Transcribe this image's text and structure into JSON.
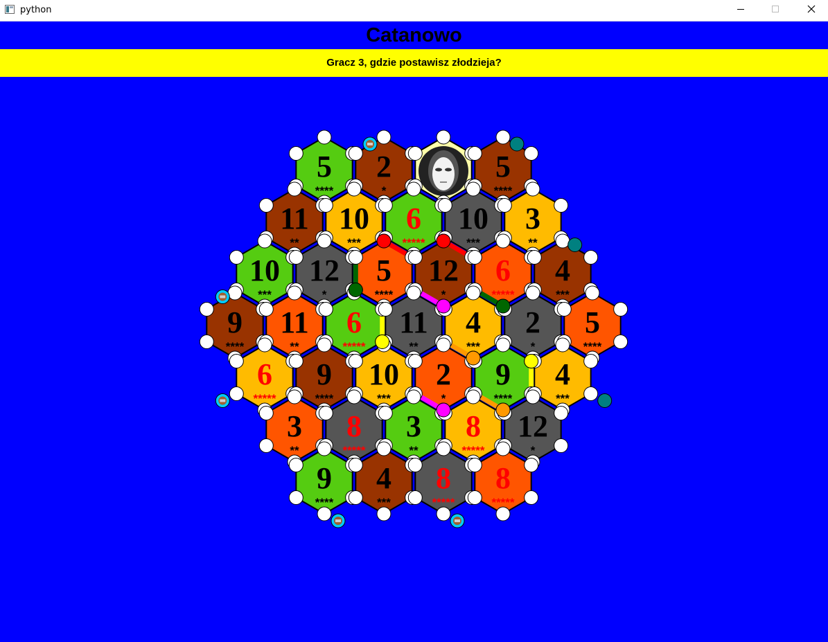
{
  "window": {
    "title": "python",
    "buttons": [
      "minimize",
      "maximize",
      "close"
    ]
  },
  "header": {
    "title": "Catanowo",
    "prompt": "Gracz 3, gdzie postawisz złodzieja?"
  },
  "colors": {
    "background": "#0000ff",
    "prompt_bar": "#ffff00",
    "green": "#55cc11",
    "brown": "#993300",
    "yellow": "#ffbb00",
    "orange": "#ff5500",
    "gray": "#555555",
    "desert": "#ffffaa",
    "hot_number": "#ff0000",
    "player_red": "#ff0000",
    "player_green": "#006600",
    "player_magenta": "#ff00ff",
    "player_yellow": "#ffff00",
    "player_orange": "#ff9900"
  },
  "board": {
    "robber": {
      "row": 0,
      "col": 2,
      "icon": "robber-mask-icon"
    },
    "rows": [
      [
        {
          "num": "5",
          "stars": "****",
          "terrain": "green"
        },
        {
          "num": "2",
          "stars": "*",
          "terrain": "brown"
        },
        {
          "num": "",
          "stars": "",
          "terrain": "desert"
        },
        {
          "num": "5",
          "stars": "****",
          "terrain": "brown"
        }
      ],
      [
        {
          "num": "11",
          "stars": "**",
          "terrain": "brown"
        },
        {
          "num": "10",
          "stars": "***",
          "terrain": "yellow"
        },
        {
          "num": "6",
          "stars": "*****",
          "terrain": "green"
        },
        {
          "num": "10",
          "stars": "***",
          "terrain": "gray"
        },
        {
          "num": "3",
          "stars": "**",
          "terrain": "yellow"
        }
      ],
      [
        {
          "num": "10",
          "stars": "***",
          "terrain": "green"
        },
        {
          "num": "12",
          "stars": "*",
          "terrain": "gray"
        },
        {
          "num": "5",
          "stars": "****",
          "terrain": "orange"
        },
        {
          "num": "12",
          "stars": "*",
          "terrain": "brown"
        },
        {
          "num": "6",
          "stars": "*****",
          "terrain": "orange"
        },
        {
          "num": "4",
          "stars": "***",
          "terrain": "brown"
        }
      ],
      [
        {
          "num": "9",
          "stars": "****",
          "terrain": "brown"
        },
        {
          "num": "11",
          "stars": "**",
          "terrain": "orange"
        },
        {
          "num": "6",
          "stars": "*****",
          "terrain": "green"
        },
        {
          "num": "11",
          "stars": "**",
          "terrain": "gray"
        },
        {
          "num": "4",
          "stars": "***",
          "terrain": "yellow"
        },
        {
          "num": "2",
          "stars": "*",
          "terrain": "gray"
        },
        {
          "num": "5",
          "stars": "****",
          "terrain": "orange"
        }
      ],
      [
        {
          "num": "6",
          "stars": "*****",
          "terrain": "yellow"
        },
        {
          "num": "9",
          "stars": "****",
          "terrain": "brown"
        },
        {
          "num": "10",
          "stars": "***",
          "terrain": "yellow"
        },
        {
          "num": "2",
          "stars": "*",
          "terrain": "orange"
        },
        {
          "num": "9",
          "stars": "****",
          "terrain": "green"
        },
        {
          "num": "4",
          "stars": "***",
          "terrain": "yellow"
        }
      ],
      [
        {
          "num": "3",
          "stars": "**",
          "terrain": "orange"
        },
        {
          "num": "8",
          "stars": "*****",
          "terrain": "gray"
        },
        {
          "num": "3",
          "stars": "**",
          "terrain": "green"
        },
        {
          "num": "8",
          "stars": "*****",
          "terrain": "yellow"
        },
        {
          "num": "12",
          "stars": "*",
          "terrain": "gray"
        }
      ],
      [
        {
          "num": "9",
          "stars": "****",
          "terrain": "green"
        },
        {
          "num": "4",
          "stars": "***",
          "terrain": "brown"
        },
        {
          "num": "8",
          "stars": "*****",
          "terrain": "gray"
        },
        {
          "num": "8",
          "stars": "*****",
          "terrain": "orange"
        }
      ]
    ],
    "roads": [
      {
        "from": [
          2,
          2,
          "n"
        ],
        "to": [
          2,
          2,
          "ne"
        ],
        "color": "player_red"
      },
      {
        "from": [
          2,
          3,
          "n"
        ],
        "to": [
          2,
          3,
          "ne"
        ],
        "color": "player_red"
      },
      {
        "from": [
          2,
          2,
          "nw"
        ],
        "to": [
          2,
          2,
          "sw"
        ],
        "color": "player_green"
      },
      {
        "from": [
          2,
          3,
          "sw"
        ],
        "to": [
          2,
          3,
          "s"
        ],
        "color": "player_magenta"
      },
      {
        "from": [
          2,
          4,
          "sw"
        ],
        "to": [
          2,
          4,
          "s"
        ],
        "color": "player_green"
      },
      {
        "from": [
          3,
          2,
          "ne"
        ],
        "to": [
          3,
          2,
          "se"
        ],
        "color": "player_yellow"
      },
      {
        "from": [
          3,
          4,
          "s"
        ],
        "to": [
          3,
          4,
          "sw"
        ],
        "color": "player_orange"
      },
      {
        "from": [
          4,
          4,
          "ne"
        ],
        "to": [
          4,
          4,
          "se"
        ],
        "color": "player_yellow"
      },
      {
        "from": [
          4,
          3,
          "s"
        ],
        "to": [
          4,
          3,
          "sw"
        ],
        "color": "player_magenta"
      },
      {
        "from": [
          4,
          4,
          "s"
        ],
        "to": [
          4,
          4,
          "sw"
        ],
        "color": "player_orange"
      }
    ],
    "settlements": [
      {
        "at": [
          2,
          2,
          "n"
        ],
        "color": "player_red"
      },
      {
        "at": [
          2,
          3,
          "n"
        ],
        "color": "player_red"
      },
      {
        "at": [
          2,
          2,
          "sw"
        ],
        "color": "player_green"
      },
      {
        "at": [
          2,
          3,
          "s"
        ],
        "color": "player_magenta"
      },
      {
        "at": [
          2,
          4,
          "s"
        ],
        "color": "player_green"
      },
      {
        "at": [
          3,
          2,
          "se"
        ],
        "color": "player_yellow"
      },
      {
        "at": [
          3,
          4,
          "s"
        ],
        "color": "player_orange"
      },
      {
        "at": [
          4,
          4,
          "ne"
        ],
        "color": "player_yellow"
      },
      {
        "at": [
          4,
          3,
          "s"
        ],
        "color": "player_magenta"
      },
      {
        "at": [
          4,
          4,
          "s"
        ],
        "color": "player_orange"
      }
    ],
    "ports": [
      {
        "icon": "clay-port-icon",
        "fill": "#00ccff",
        "at": [
          0,
          1,
          "n"
        ],
        "side": "left"
      },
      {
        "icon": "generic-port-icon",
        "fill": "#008080",
        "at": [
          0,
          3,
          "n"
        ],
        "side": "right"
      },
      {
        "icon": "generic-port-icon",
        "fill": "#008080",
        "at": [
          1,
          4,
          "se"
        ],
        "side": "right"
      },
      {
        "icon": "wool-port-icon",
        "fill": "#00ccff",
        "at": [
          2,
          0,
          "sw"
        ],
        "side": "left"
      },
      {
        "icon": "generic-port-icon",
        "fill": "#008080",
        "at": [
          4,
          5,
          "se"
        ],
        "side": "right"
      },
      {
        "icon": "stone-port-icon",
        "fill": "#00ccff",
        "at": [
          4,
          0,
          "sw"
        ],
        "side": "left"
      },
      {
        "icon": "wheat-port-icon",
        "fill": "#00ccff",
        "at": [
          6,
          0,
          "s"
        ],
        "side": "right"
      },
      {
        "icon": "wool-port-icon",
        "fill": "#00ccff",
        "at": [
          6,
          2,
          "s"
        ],
        "side": "right"
      }
    ]
  }
}
